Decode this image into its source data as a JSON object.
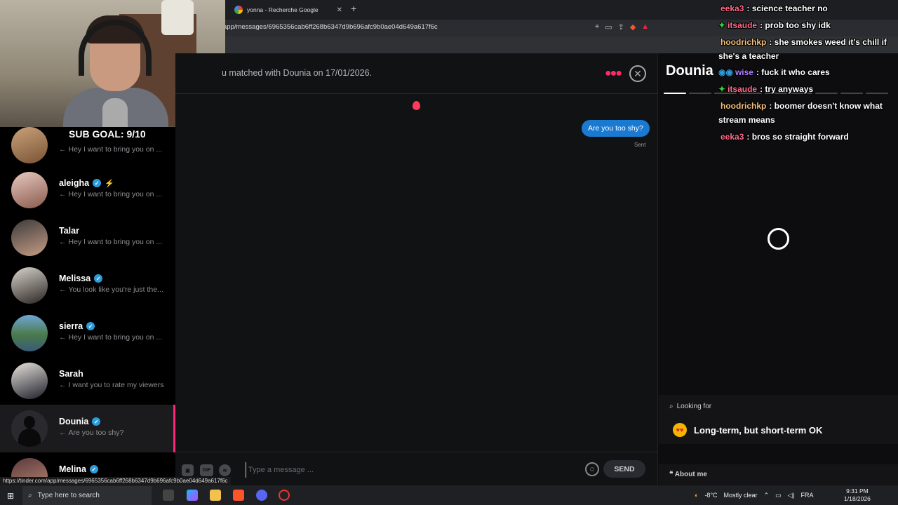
{
  "browser": {
    "tab_title": "yonna - Recherche Google",
    "url": "app/messages/6965356cab6ff268b6347d9b696afc9b0ae04d649a617f6c",
    "status_url": "https://tinder.com/app/messages/6965356cab6ff268b6347d9b696afc9b0ae04d649a617f6c"
  },
  "overlay": {
    "sub_goal": "SUB GOAL: 9/10"
  },
  "matches": [
    {
      "name": "",
      "message": "Hey I want to bring you on ...",
      "verified": false
    },
    {
      "name": "aleigha",
      "message": "Hey I want to bring you on ...",
      "verified": true,
      "bolt": true
    },
    {
      "name": "Talar",
      "message": "Hey I want to bring you on ...",
      "verified": false
    },
    {
      "name": "Melissa",
      "message": "You look like you're just the...",
      "verified": true
    },
    {
      "name": "sierra",
      "message": "Hey I want to bring you on ...",
      "verified": true
    },
    {
      "name": "Sarah",
      "message": "I want you to rate my viewers",
      "verified": false
    },
    {
      "name": "Dounia",
      "message": "Are you too shy?",
      "verified": true,
      "active": true
    },
    {
      "name": "Melina",
      "message": "",
      "verified": true
    }
  ],
  "chat": {
    "matched_text": "u matched with Dounia on 17/01/2026.",
    "messages": [
      {
        "text": "Are you too shy?",
        "status": "Sent"
      }
    ],
    "input_placeholder": "Type a message ...",
    "gif_label": "GIF",
    "send_label": "SEND"
  },
  "profile": {
    "name": "Dounia",
    "looking_for_label": "Looking for",
    "looking_for_value": "Long-term, but short-term OK",
    "about_label": "About me"
  },
  "stream_chat": [
    {
      "user": "eeka3",
      "color": "#ff6b8a",
      "text": ": science teacher no"
    },
    {
      "user": "itsaude",
      "color": "#ff6b8a",
      "text": ": prob too shy idk",
      "badge": true
    },
    {
      "user": "hoodrichkp",
      "color": "#f0c080",
      "text": ": she smokes weed it's chill if she's a teacher"
    },
    {
      "user": "wise",
      "color": "#b07cff",
      "text": ": fuck it who cares",
      "badge": true
    },
    {
      "user": "itsaude",
      "color": "#ff6b8a",
      "text": ": try anyways",
      "badge": true
    },
    {
      "user": "hoodrichkp",
      "color": "#f0c080",
      "text": ": boomer doesn't know what stream means"
    },
    {
      "user": "eeka3",
      "color": "#ff6b8a",
      "text": ": bros so straight forward"
    }
  ],
  "taskbar": {
    "search_placeholder": "Type here to search",
    "weather": "-8°C",
    "weather_desc": "Mostly clear",
    "lang": "FRA",
    "time": "9:31 PM",
    "date": "1/18/2026"
  },
  "colors": {
    "accent": "#fd267a",
    "bubble": "#1a79d1",
    "verified": "#2d9cdb"
  }
}
